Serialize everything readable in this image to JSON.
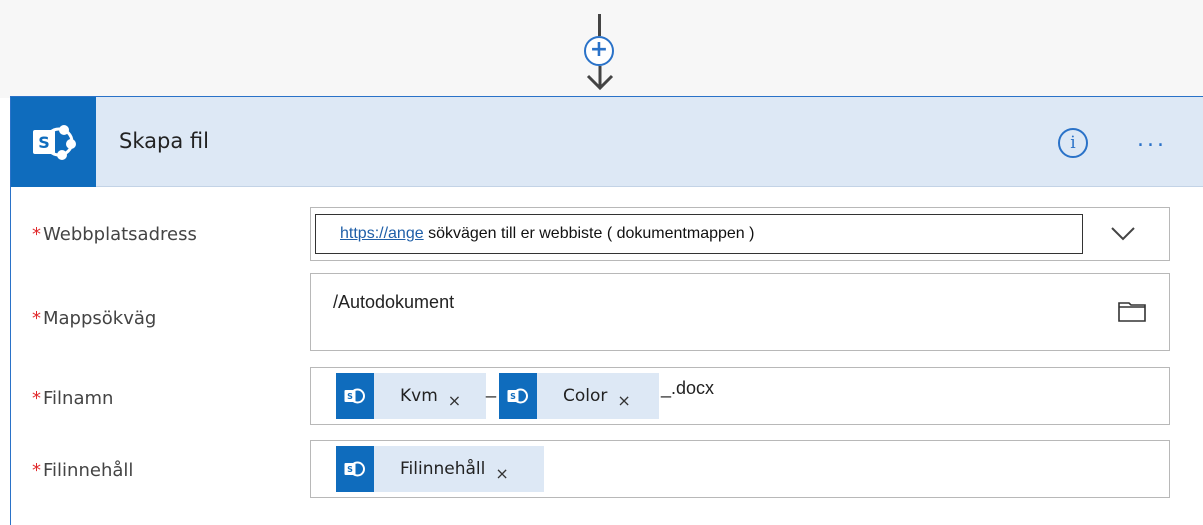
{
  "colors": {
    "accent": "#2a72c8",
    "sharepoint": "#0f6cbd",
    "header_bg": "#dde8f5",
    "required": "#e0292b"
  },
  "connector": {
    "add_icon": "plus-circle-icon",
    "arrow_icon": "arrow-down-icon"
  },
  "action": {
    "title": "Skapa fil",
    "logo_icon": "sharepoint-icon",
    "info_icon": "info-icon",
    "more_icon": "ellipsis-icon",
    "more_label": "..."
  },
  "fields": {
    "site_address": {
      "required_mark": "*",
      "label": "Webbplatsadress",
      "value_link": "https://ange",
      "value_rest": " sökvägen till er webbiste ( dokumentmappen )",
      "dropdown_icon": "chevron-down-icon"
    },
    "folder_path": {
      "required_mark": "*",
      "label": "Mappsökväg",
      "value": "/Autodokument",
      "picker_icon": "folder-icon"
    },
    "file_name": {
      "required_mark": "*",
      "label": "Filnamn",
      "tokens": [
        {
          "label": "Kvm",
          "remove": "×"
        },
        {
          "label": "Color",
          "remove": "×"
        }
      ],
      "separator_1": "_",
      "separator_2": "_.docx"
    },
    "file_content": {
      "required_mark": "*",
      "label": "Filinnehåll",
      "tokens": [
        {
          "label": "Filinnehåll",
          "remove": "×"
        }
      ]
    }
  }
}
